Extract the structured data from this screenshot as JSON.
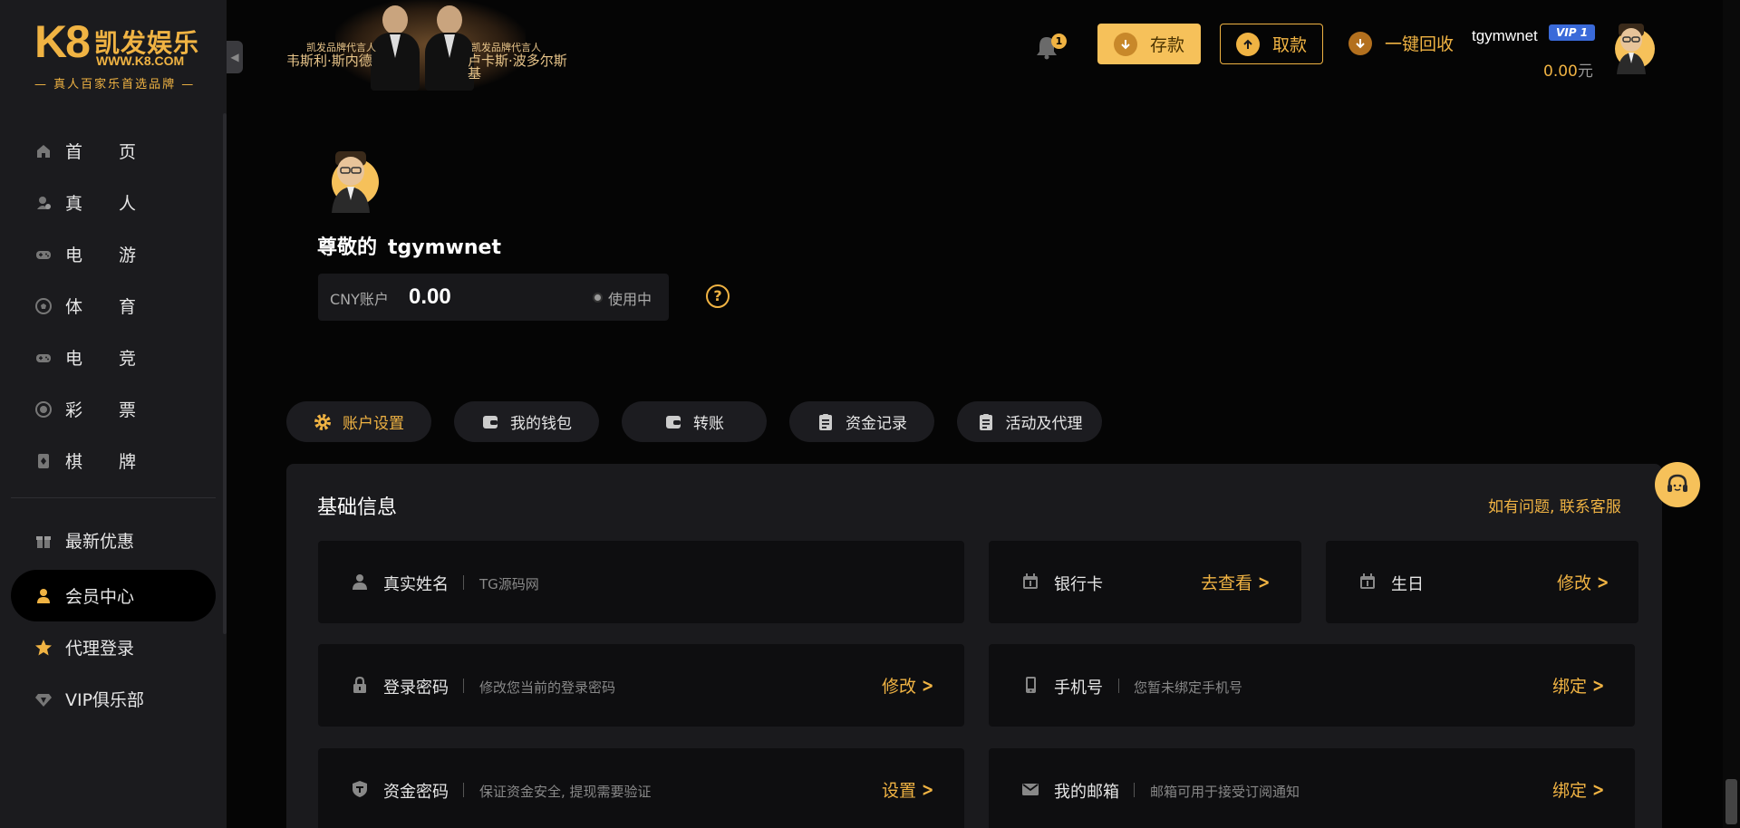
{
  "brand": {
    "logo_mark": "K8",
    "name": "凯发娱乐",
    "site": "WWW.K8.COM",
    "slogan": "— 真人百家乐首选品牌 —"
  },
  "banner": {
    "left_caption_small": "凯发品牌代言人",
    "left_caption_big": "韦斯利·斯内德",
    "right_caption_small": "凯发品牌代言人",
    "right_caption_big": "卢卡斯·波多尔斯基"
  },
  "sidebar": {
    "items": [
      {
        "label": "首页",
        "icon": "home-icon"
      },
      {
        "label": "真人",
        "icon": "live-casino-icon"
      },
      {
        "label": "电游",
        "icon": "gamepad-icon"
      },
      {
        "label": "体育",
        "icon": "soccer-ball-icon"
      },
      {
        "label": "电竞",
        "icon": "esports-icon"
      },
      {
        "label": "彩票",
        "icon": "lottery-icon"
      },
      {
        "label": "棋牌",
        "icon": "cards-icon"
      }
    ],
    "extra": [
      {
        "label": "最新优惠",
        "icon": "gift-icon"
      },
      {
        "label": "会员中心",
        "icon": "member-icon",
        "active": true
      },
      {
        "label": "代理登录",
        "icon": "star-icon"
      },
      {
        "label": "VIP俱乐部",
        "icon": "diamond-icon"
      }
    ]
  },
  "header": {
    "notification_count": "1",
    "deposit_label": "存款",
    "withdraw_label": "取款",
    "recycle_label": "一键回收",
    "username": "tgymwnet",
    "vip_level": "VIP 1",
    "balance": "0.00",
    "balance_unit": "元"
  },
  "profile": {
    "greeting": "尊敬的",
    "username": "tgymwnet",
    "account_label": "CNY账户",
    "account_value": "0.00",
    "account_status": "使用中",
    "help": "?"
  },
  "tabs": [
    {
      "label": "账户设置",
      "icon": "gear-icon",
      "active": true
    },
    {
      "label": "我的钱包",
      "icon": "wallet-icon"
    },
    {
      "label": "转账",
      "icon": "transfer-icon"
    },
    {
      "label": "资金记录",
      "icon": "record-icon"
    },
    {
      "label": "活动及代理",
      "icon": "activity-icon"
    }
  ],
  "panel": {
    "title": "基础信息",
    "contact_link": "如有问题, 联系客服",
    "cards": {
      "real_name": {
        "title": "真实姓名",
        "desc": "TG源码网"
      },
      "bank_card": {
        "title": "银行卡",
        "action": "去查看"
      },
      "birthday": {
        "title": "生日",
        "action": "修改"
      },
      "login_password": {
        "title": "登录密码",
        "desc": "修改您当前的登录密码",
        "action": "修改"
      },
      "phone": {
        "title": "手机号",
        "desc": "您暂未绑定手机号",
        "action": "绑定"
      },
      "fund_password": {
        "title": "资金密码",
        "desc": "保证资金安全, 提现需要验证",
        "action": "设置"
      },
      "email": {
        "title": "我的邮箱",
        "desc": "邮箱可用于接受订阅通知",
        "action": "绑定"
      }
    }
  },
  "colors": {
    "accent": "#f0b343",
    "sidebar_bg": "#1b1b1e",
    "page_bg": "#050505",
    "panel_bg": "#1a1a1d",
    "card_bg": "#0e0e10"
  }
}
